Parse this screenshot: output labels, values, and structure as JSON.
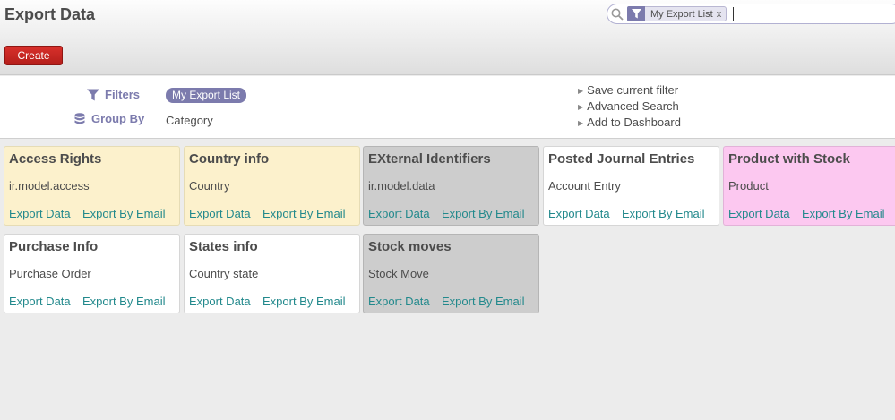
{
  "header": {
    "title": "Export Data",
    "create_label": "Create"
  },
  "search": {
    "facet_label": "My Export List",
    "facet_remove": "x"
  },
  "filter_panel": {
    "filters_label": "Filters",
    "active_filter": "My Export List",
    "group_by_label": "Group By",
    "group_by_value": "Category",
    "menu": [
      "Save current filter",
      "Advanced Search",
      "Add to Dashboard"
    ]
  },
  "card_links": {
    "export_data": "Export Data",
    "export_by_email": "Export By Email"
  },
  "cards": [
    {
      "title": "Access Rights",
      "subtitle": "ir.model.access",
      "color": "#fcf1cc"
    },
    {
      "title": "Country info",
      "subtitle": "Country",
      "color": "#fcf1cc"
    },
    {
      "title": "EXternal Identifiers",
      "subtitle": "ir.model.data",
      "color": "#cdcdcd"
    },
    {
      "title": "Posted Journal Entries",
      "subtitle": "Account Entry",
      "color": "#ffffff"
    },
    {
      "title": "Product with Stock",
      "subtitle": "Product",
      "color": "#fcc8f0"
    },
    {
      "title": "Purchase Info",
      "subtitle": "Purchase Order",
      "color": "#ffffff"
    },
    {
      "title": "States info",
      "subtitle": "Country state",
      "color": "#ffffff"
    },
    {
      "title": "Stock moves",
      "subtitle": "Stock Move",
      "color": "#cdcdcd"
    }
  ],
  "colors": {
    "accent": "#7c7bad",
    "link": "#22898c",
    "create_button": "#c9262a"
  }
}
